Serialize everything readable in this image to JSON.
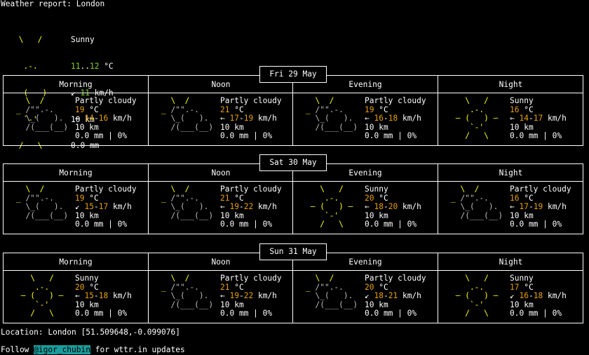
{
  "title": "Weather report: London",
  "current": {
    "art": [
      " \\   /    ",
      "  .-.     ",
      "― (   ) ― ",
      "  `-'     ",
      " /   \\    "
    ],
    "condition": "Sunny",
    "temp_low": "11",
    "temp_sep": "..",
    "temp_high": "12",
    "temp_unit": " °C",
    "wind_arrow": "↙",
    "wind": "11",
    "wind_unit": " km/h",
    "visibility": "10 km",
    "precip": "0.0 mm"
  },
  "periods": [
    "Morning",
    "Noon",
    "Evening",
    "Night"
  ],
  "days": [
    {
      "date": "Fri 29 May",
      "cells": [
        {
          "art": [
            "  \\  /     ",
            "_ /\"\".-.   ",
            "  \\_(   ). ",
            "  /(___(__)",
            "           "
          ],
          "condition": "Partly cloudy",
          "temp": "19",
          "arrow": "←",
          "wind_lo": "14",
          "wind_hi": "16",
          "vis": "10 km",
          "precip": "0.0 mm | 0%"
        },
        {
          "art": [
            "  \\  /     ",
            "_ /\"\".-.   ",
            "  \\_(   ). ",
            "  /(___(__)",
            "           "
          ],
          "condition": "Partly cloudy",
          "temp": "21",
          "arrow": "←",
          "wind_lo": "17",
          "wind_hi": "19",
          "vis": "10 km",
          "precip": "0.0 mm | 0%"
        },
        {
          "art": [
            "  \\  /     ",
            "_ /\"\".-.   ",
            "  \\_(   ). ",
            "  /(___(__)",
            "           "
          ],
          "condition": "Partly cloudy",
          "temp": "19",
          "arrow": "←",
          "wind_lo": "16",
          "wind_hi": "18",
          "vis": "10 km",
          "precip": "0.0 mm | 0%"
        },
        {
          "art": [
            "   \\   /   ",
            "    .-.    ",
            " ― (   ) ― ",
            "    `-'    ",
            "   /   \\   "
          ],
          "condition": "Sunny",
          "temp": "16",
          "arrow": "←",
          "wind_lo": "14",
          "wind_hi": "17",
          "vis": "10 km",
          "precip": "0.0 mm | 0%"
        }
      ]
    },
    {
      "date": "Sat 30 May",
      "cells": [
        {
          "art": [
            "  \\  /     ",
            "_ /\"\".-.   ",
            "  \\_(   ). ",
            "  /(___(__)",
            "           "
          ],
          "condition": "Partly cloudy",
          "temp": "19",
          "arrow": "↙",
          "wind_lo": "15",
          "wind_hi": "17",
          "vis": "10 km",
          "precip": "0.0 mm | 0%"
        },
        {
          "art": [
            "  \\  /     ",
            "_ /\"\".-.   ",
            "  \\_(   ). ",
            "  /(___(__)",
            "           "
          ],
          "condition": "Partly cloudy",
          "temp": "21",
          "arrow": "←",
          "wind_lo": "19",
          "wind_hi": "22",
          "vis": "10 km",
          "precip": "0.0 mm | 0%"
        },
        {
          "art": [
            "   \\   /   ",
            "    .-.    ",
            " ― (   ) ― ",
            "    `-'    ",
            "   /   \\   "
          ],
          "condition": "Sunny",
          "temp": "20",
          "arrow": "←",
          "wind_lo": "18",
          "wind_hi": "20",
          "vis": "10 km",
          "precip": "0.0 mm | 0%"
        },
        {
          "art": [
            "  \\  /     ",
            "_ /\"\".-.   ",
            "  \\_(   ). ",
            "  /(___(__)",
            "           "
          ],
          "condition": "Partly cloudy",
          "temp": "16",
          "arrow": "←",
          "wind_lo": "17",
          "wind_hi": "19",
          "vis": "10 km",
          "precip": "0.0 mm | 0%"
        }
      ]
    },
    {
      "date": "Sun 31 May",
      "cells": [
        {
          "art": [
            "   \\   /   ",
            "    .-.    ",
            " ― (   ) ― ",
            "    `-'    ",
            "   /   \\   "
          ],
          "condition": "Sunny",
          "temp": "20",
          "arrow": "←",
          "wind_lo": "15",
          "wind_hi": "18",
          "vis": "10 km",
          "precip": "0.0 mm | 0%"
        },
        {
          "art": [
            "  \\  /     ",
            "_ /\"\".-.   ",
            "  \\_(   ). ",
            "  /(___(__)",
            "           "
          ],
          "condition": "Partly cloudy",
          "temp": "21",
          "arrow": "←",
          "wind_lo": "19",
          "wind_hi": "22",
          "vis": "10 km",
          "precip": "0.0 mm | 0%"
        },
        {
          "art": [
            "  \\  /     ",
            "_ /\"\".-.   ",
            "  \\_(   ). ",
            "  /(___(__)",
            "           "
          ],
          "condition": "Partly cloudy",
          "temp": "20",
          "arrow": "↙",
          "wind_lo": "18",
          "wind_hi": "21",
          "vis": "10 km",
          "precip": "0.0 mm | 0%"
        },
        {
          "art": [
            "   \\   /   ",
            "    .-.    ",
            " ― (   ) ― ",
            "    `-'    ",
            "   /   \\   "
          ],
          "condition": "Sunny",
          "temp": "17",
          "arrow": "↙",
          "wind_lo": "16",
          "wind_hi": "18",
          "vis": "10 km",
          "precip": "0.0 mm | 0%"
        }
      ]
    }
  ],
  "temp_unit": " °C",
  "wind_dash": "-",
  "wind_unit": " km/h",
  "location": "Location: London [51.509648,-0.099076]",
  "follow_prefix": "Follow ",
  "follow_handle": "@igor_chubin",
  "follow_suffix": " for wttr.in updates",
  "colors": {
    "sun": "#ffff00",
    "warm_temp": "#e8a000",
    "current_temp": "#7cd62a",
    "handle_bg": "#1a9c9c"
  }
}
